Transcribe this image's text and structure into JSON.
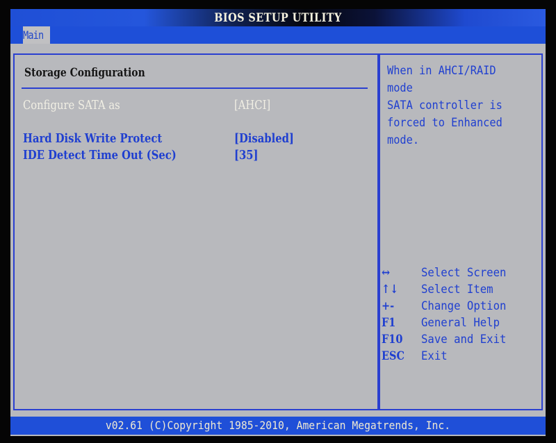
{
  "window": {
    "title": "BIOS SETUP UTILITY"
  },
  "tabs": [
    {
      "label": "Main",
      "active": true
    }
  ],
  "main": {
    "section_title": "Storage Configuration",
    "settings": [
      {
        "label": "Configure SATA as",
        "value": "[AHCI]",
        "selected": true
      },
      {
        "label": "Hard Disk Write Protect",
        "value": "[Disabled]",
        "selected": false
      },
      {
        "label": "IDE Detect Time Out (Sec)",
        "value": "[35]",
        "selected": false
      }
    ]
  },
  "help": {
    "text": "When in AHCI/RAID mode\nSATA controller is\nforced to Enhanced\nmode."
  },
  "key_legend": [
    {
      "key": "↔",
      "icon": "left-right-arrow-icon",
      "description": "Select Screen"
    },
    {
      "key": "↑↓",
      "icon": "up-down-arrow-icon",
      "description": "Select Item"
    },
    {
      "key": "+-",
      "icon": "plus-minus-icon",
      "description": "Change Option"
    },
    {
      "key": "F1",
      "description": "General Help"
    },
    {
      "key": "F10",
      "description": "Save and Exit"
    },
    {
      "key": "ESC",
      "description": "Exit"
    }
  ],
  "footer": {
    "text": "v02.61 (C)Copyright 1985-2010, American Megatrends, Inc."
  },
  "colors": {
    "bios_blue": "#1f4fd8",
    "text_blue": "#1f3fd0",
    "panel_gray": "#b8b9bd",
    "highlight_text": "#f1efe4"
  }
}
